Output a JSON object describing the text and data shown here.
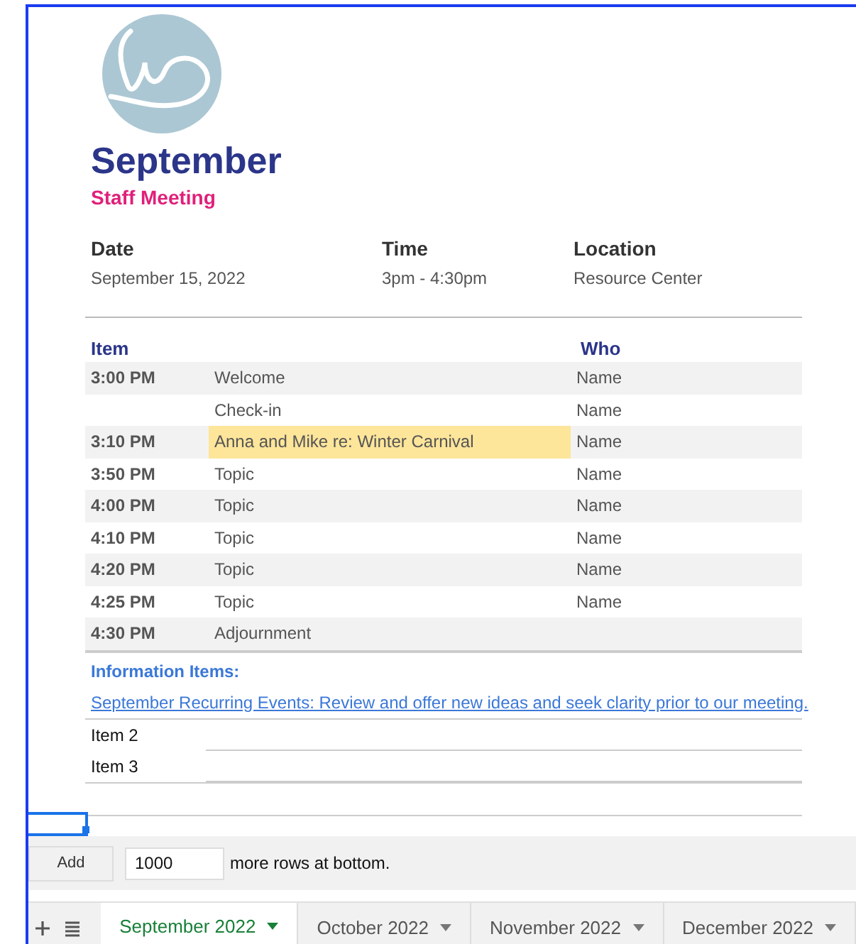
{
  "header": {
    "title": "September",
    "subtitle": "Staff Meeting"
  },
  "details": [
    {
      "label": "Date",
      "value": "September 15, 2022"
    },
    {
      "label": "Time",
      "value": "3pm - 4:30pm"
    },
    {
      "label": "Location",
      "value": "Resource Center"
    }
  ],
  "agenda": {
    "columns": [
      "Item",
      "Who"
    ],
    "rows": [
      {
        "time": "3:00 PM",
        "item": "Welcome",
        "who": "Name",
        "highlighted": false
      },
      {
        "time": "",
        "item": "Check-in",
        "who": "Name",
        "highlighted": false
      },
      {
        "time": "3:10 PM",
        "item": "Anna and Mike re: Winter Carnival",
        "who": "Name",
        "highlighted": true
      },
      {
        "time": "3:50 PM",
        "item": "Topic",
        "who": "Name",
        "highlighted": false
      },
      {
        "time": "4:00 PM",
        "item": "Topic",
        "who": "Name",
        "highlighted": false
      },
      {
        "time": "4:10 PM",
        "item": "Topic",
        "who": "Name",
        "highlighted": false
      },
      {
        "time": "4:20 PM",
        "item": "Topic",
        "who": "Name",
        "highlighted": false
      },
      {
        "time": "4:25 PM",
        "item": "Topic",
        "who": "Name",
        "highlighted": false
      },
      {
        "time": "4:30 PM",
        "item": "Adjournment",
        "who": "",
        "highlighted": false
      }
    ]
  },
  "info": {
    "heading": "Information Items:",
    "link": "September Recurring Events: Review and offer new ideas and seek clarity prior to our meeting.",
    "items": [
      "Item 2",
      "Item 3"
    ]
  },
  "add_rows": {
    "button": "Add",
    "value": "1000",
    "suffix": "more rows at bottom."
  },
  "sheet_tabs": [
    {
      "label": "September 2022",
      "selected": true
    },
    {
      "label": "October 2022",
      "selected": false
    },
    {
      "label": "November 2022",
      "selected": false
    },
    {
      "label": "December 2022",
      "selected": false
    }
  ]
}
